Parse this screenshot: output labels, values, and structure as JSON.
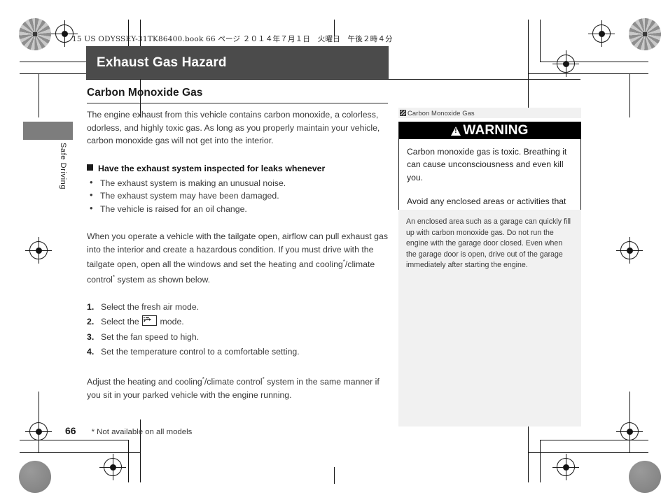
{
  "print_meta": "15 US ODYSSEY-31TK86400.book  66 ページ  ２０１４年７月１日　火曜日　午後２時４分",
  "side_tab": {
    "label": "Safe Driving"
  },
  "title_bar": {
    "title": "Exhaust Gas Hazard"
  },
  "section": {
    "heading": "Carbon Monoxide Gas",
    "intro": "The engine exhaust from this vehicle contains carbon monoxide, a colorless, odorless, and highly toxic gas. As long as you properly maintain your vehicle, carbon monoxide gas will not get into the interior.",
    "subheading": "Have the exhaust system inspected for leaks whenever",
    "bullets": [
      "The exhaust system is making an unusual noise.",
      "The exhaust system may have been damaged.",
      "The vehicle is raised for an oil change."
    ],
    "tailgate_para_1": "When you operate a vehicle with the tailgate open, airflow can pull exhaust gas into the interior and create a hazardous condition. If you must drive with the tailgate open, open all the windows and set the heating and cooling",
    "tailgate_para_2": "/climate control",
    "tailgate_para_3": " system as shown below.",
    "steps": [
      {
        "num": "1.",
        "text_before": "Select the fresh air mode.",
        "icon": null,
        "text_after": ""
      },
      {
        "num": "2.",
        "text_before": "Select the ",
        "icon": "recirculation-icon",
        "text_after": " mode."
      },
      {
        "num": "3.",
        "text_before": "Set the fan speed to high.",
        "icon": null,
        "text_after": ""
      },
      {
        "num": "4.",
        "text_before": "Set the temperature control to a comfortable setting.",
        "icon": null,
        "text_after": ""
      }
    ],
    "closing_para_1": "Adjust the heating and cooling",
    "closing_para_2": "/climate control",
    "closing_para_3": " system in the same manner if you sit in your parked vehicle with the engine running.",
    "star": "*"
  },
  "reference_bar": {
    "marker_icon": "page-reference-icon",
    "text": "Carbon Monoxide Gas"
  },
  "warning": {
    "icon": "warning-triangle-icon",
    "title": "WARNING",
    "paragraphs": [
      "Carbon monoxide gas is toxic. Breathing it can cause unconsciousness and even kill you.",
      "Avoid any enclosed areas or activities that expose you to carbon monoxide."
    ]
  },
  "note_panel": {
    "text": "An enclosed area such as a garage can quickly fill up with carbon monoxide gas. Do not run the engine with the garage door closed. Even when the garage door is open, drive out of the garage immediately after starting the engine."
  },
  "footer": {
    "page_number": "66",
    "footnote": "* Not available on all models"
  },
  "colors": {
    "title_bar_bg": "#4b4b4b",
    "warning_header_bg": "#000000",
    "note_panel_bg": "#f1f1f1",
    "reference_bar_bg": "#f1f1f1",
    "side_tab_bg": "#7d7d7d"
  }
}
